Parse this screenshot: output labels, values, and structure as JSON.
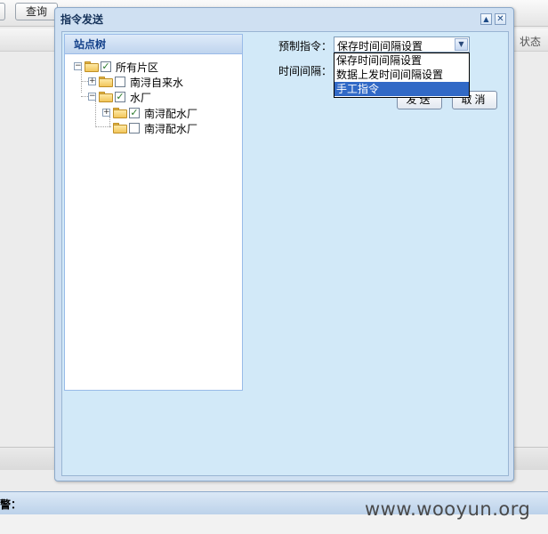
{
  "background": {
    "query_button": "查询",
    "status_column": "状态",
    "alarm_label": "警："
  },
  "watermark": "www.wooyun.org",
  "dialog": {
    "title": "指令发送",
    "tree": {
      "header": "站点树",
      "nodes": [
        {
          "label": "所有片区",
          "checked": true,
          "expanded": true
        },
        {
          "label": "南浔自来水",
          "checked": false,
          "expanded": false
        },
        {
          "label": "水厂",
          "checked": true,
          "expanded": true
        },
        {
          "label": "南浔配水厂",
          "checked": true,
          "expanded": false
        },
        {
          "label": "南浔配水厂",
          "checked": false,
          "expanded": false
        }
      ]
    },
    "form": {
      "preset_label": "预制指令：",
      "interval_label": "时间间隔：",
      "preset_selected": "保存时间间隔设置",
      "preset_options": [
        "保存时间间隔设置",
        "数据上发时间间隔设置",
        "手工指令"
      ],
      "highlighted_option": "手工指令",
      "send_button": "发送",
      "cancel_button": "取消"
    }
  }
}
